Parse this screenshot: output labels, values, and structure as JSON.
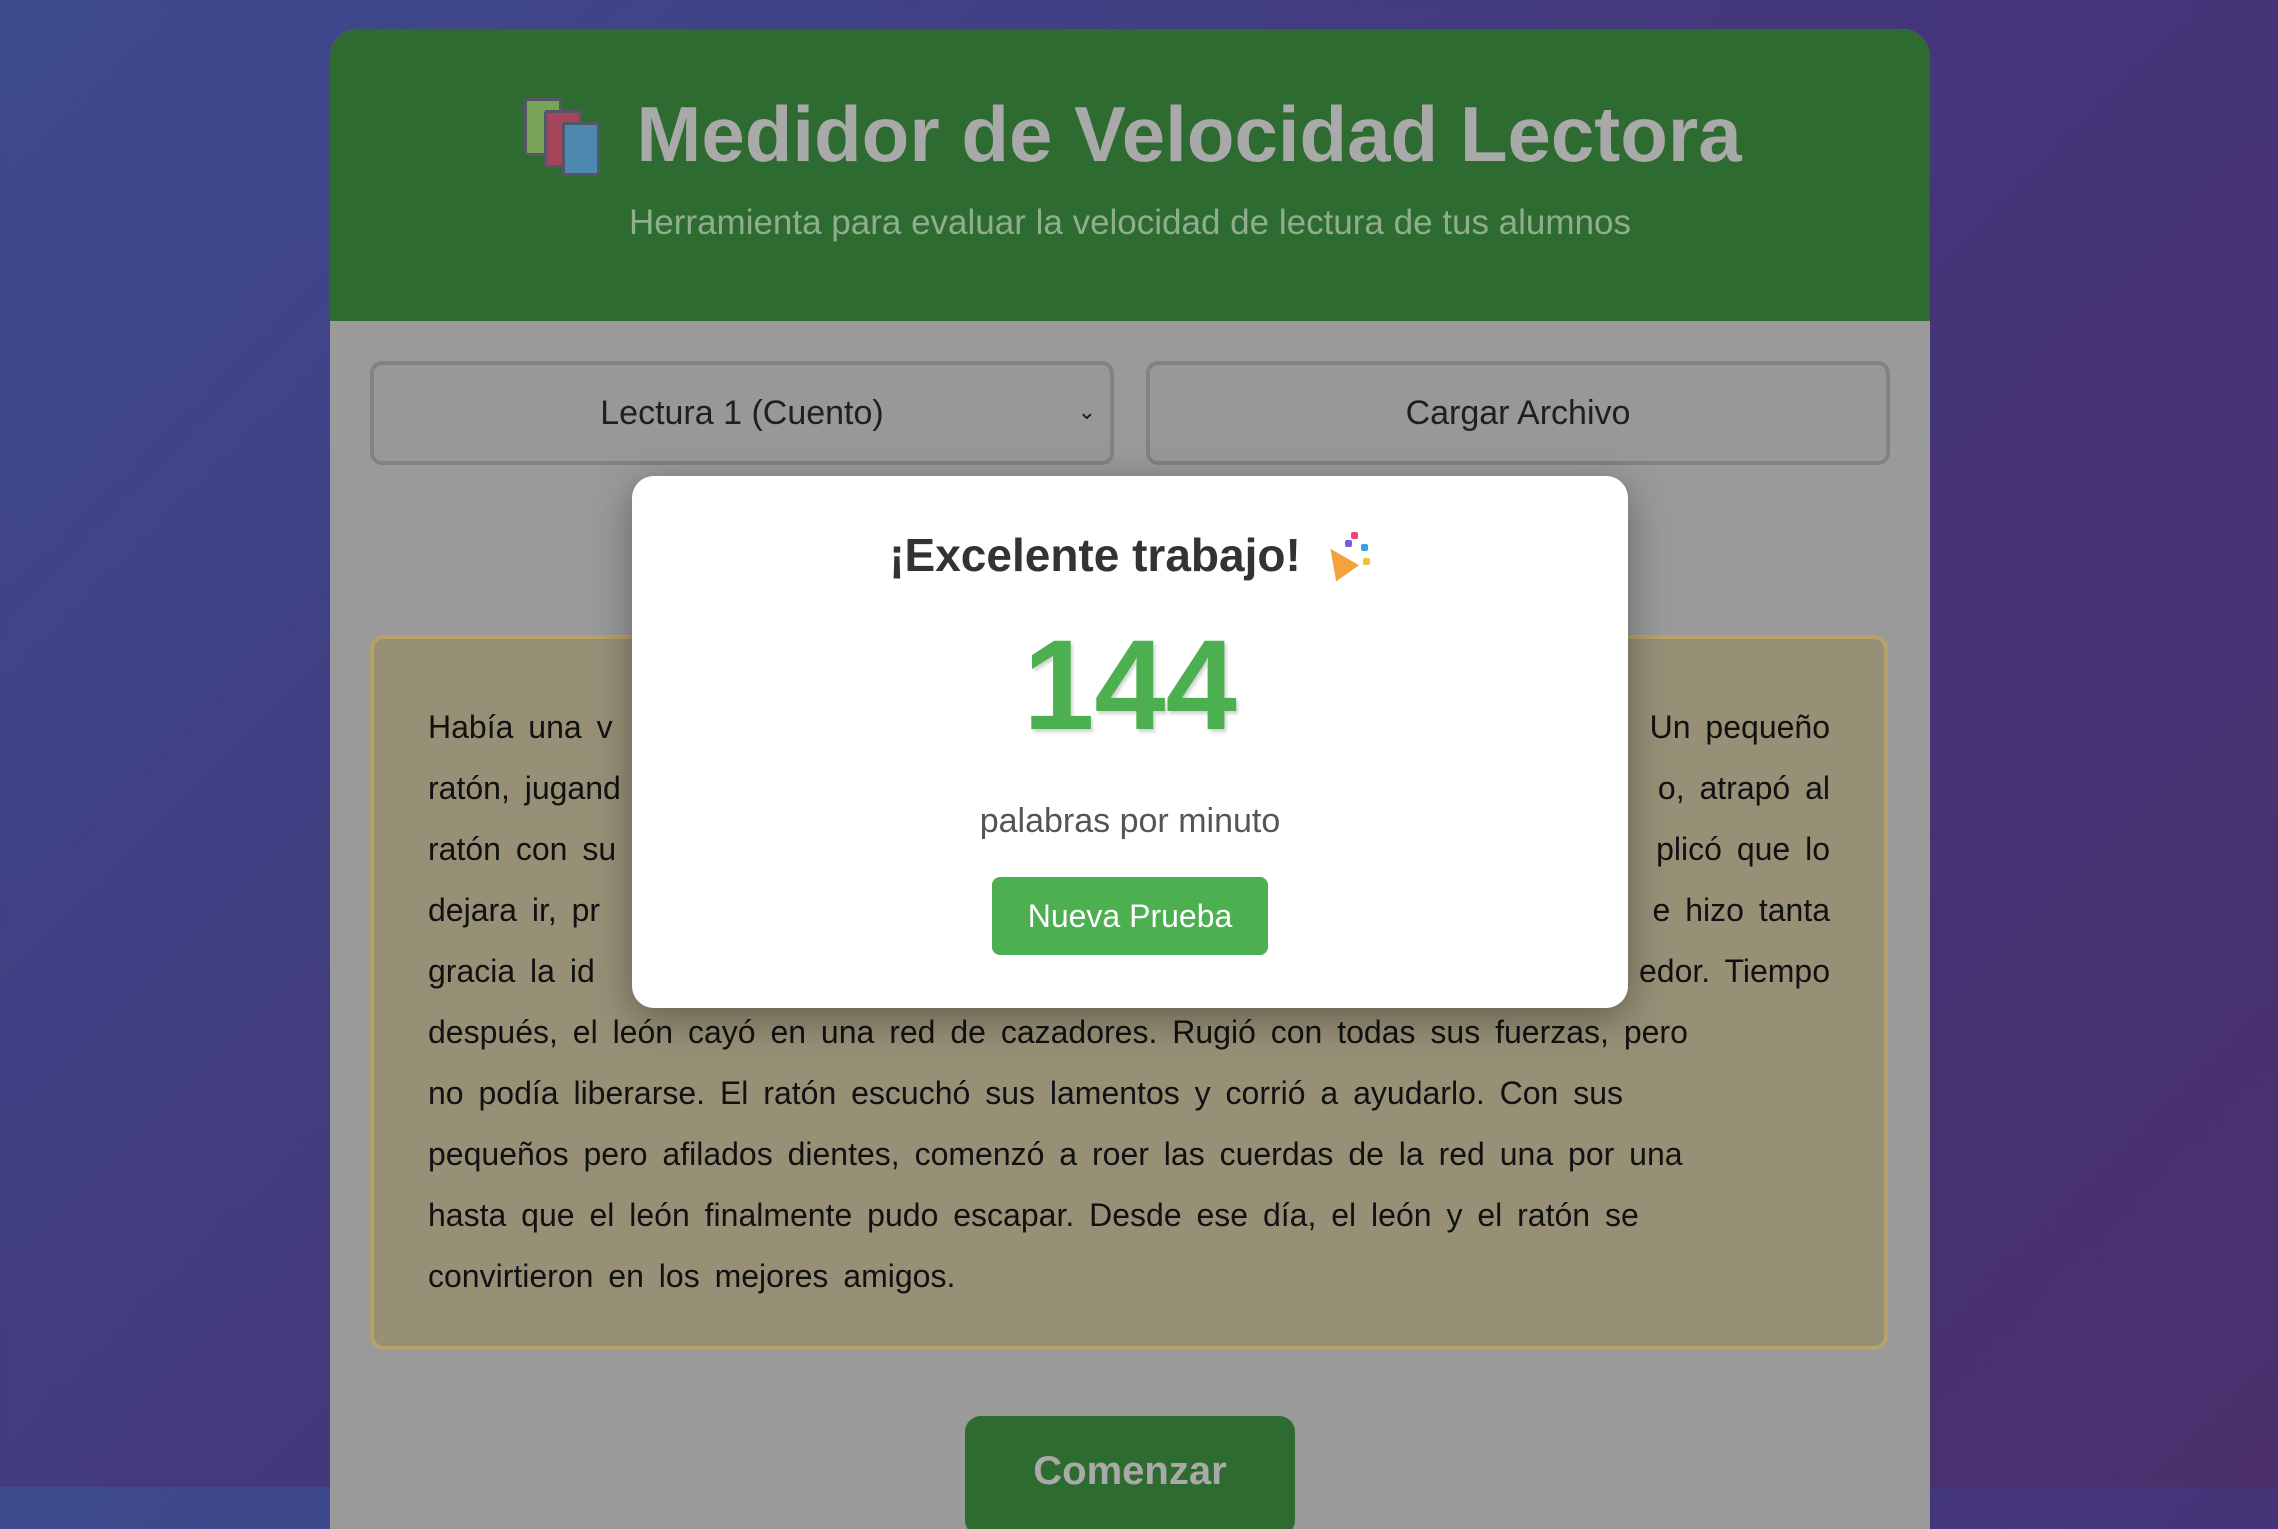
{
  "header": {
    "icon": "books-icon",
    "title": "Medidor de Velocidad Lectora",
    "subtitle": "Herramienta para evaluar la velocidad de lectura de tus alumnos"
  },
  "controls": {
    "reading_select": {
      "selected": "Lectura 1 (Cuento)"
    },
    "load_file_label": "Cargar Archivo"
  },
  "reading_text": {
    "lines": [
      "Había una v",
      "ratón, jugand",
      "ratón con su",
      "dejara ir, pr",
      "gracia la id",
      "después, el león cayó en una red de cazadores. Rugió con todas sus fuerzas, pero",
      "no podía liberarse. El ratón escuchó sus lamentos y corrió a ayudarlo. Con sus",
      "pequeños pero afilados dientes, comenzó a roer las cuerdas de la red una por una",
      "hasta que el león finalmente pudo escapar. Desde ese día, el león y el ratón se",
      "convirtieron en los mejores amigos."
    ],
    "right_fragments": [
      "Un pequeño",
      "o, atrapó al",
      "plicó que lo",
      "e hizo tanta",
      "edor. Tiempo"
    ]
  },
  "start_button_label": "Comenzar",
  "modal": {
    "title": "¡Excelente trabajo!",
    "title_icon": "party-popper-icon",
    "wpm_value": "144",
    "wpm_label": "palabras por minuto",
    "new_test_label": "Nueva Prueba"
  },
  "colors": {
    "header_green": "#2e6b31",
    "accent_green": "#4caf50",
    "overlay_gray": "#9a9a9a"
  }
}
